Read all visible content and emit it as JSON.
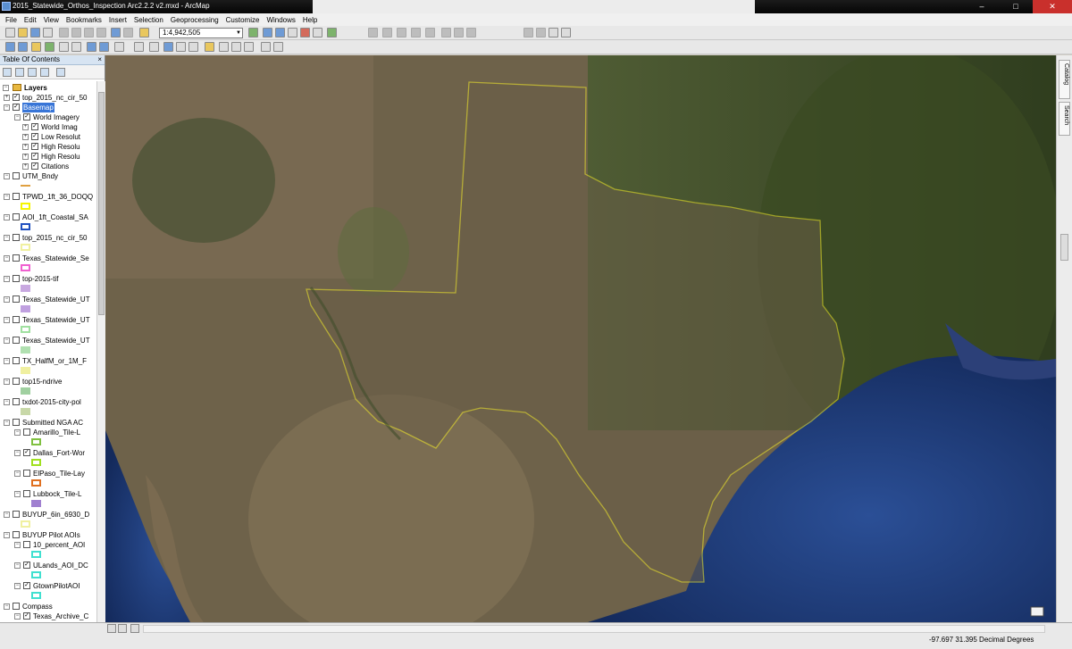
{
  "window": {
    "title": "2015_Statewide_Orthos_Inspection Arc2.2.2 v2.mxd - ArcMap",
    "controls": [
      "–",
      "□",
      "✕"
    ]
  },
  "menu": [
    "File",
    "Edit",
    "View",
    "Bookmarks",
    "Insert",
    "Selection",
    "Geoprocessing",
    "Customize",
    "Windows",
    "Help"
  ],
  "toolbar": {
    "scale_value": "1:4,942,505"
  },
  "toc": {
    "title": "Table Of Contents",
    "layers_root": "Layers",
    "rows": [
      {
        "label": "top_2015_nc_cir_50",
        "checked": true,
        "level": 1,
        "exp": "+"
      },
      {
        "label": "Basemap",
        "checked": true,
        "level": 1,
        "exp": "−",
        "selected": true
      },
      {
        "label": "World Imagery",
        "checked": true,
        "level": 2,
        "exp": "−"
      },
      {
        "label": "World Imag",
        "checked": true,
        "level": 3,
        "exp": "+"
      },
      {
        "label": "Low Resolut",
        "checked": true,
        "level": 3,
        "exp": "+"
      },
      {
        "label": "High Resolu",
        "checked": true,
        "level": 3,
        "exp": "+"
      },
      {
        "label": "High Resolu",
        "checked": true,
        "level": 3,
        "exp": "+"
      },
      {
        "label": "Citations",
        "checked": true,
        "level": 3,
        "exp": "+"
      },
      {
        "label": "UTM_Bndy",
        "checked": false,
        "level": 1,
        "exp": "−",
        "symbol": "#e0a040",
        "symbol_kind": "line"
      },
      {
        "label": "TPWD_1ft_36_DOQQ",
        "checked": false,
        "level": 1,
        "exp": "−",
        "symbol": "#f5f500"
      },
      {
        "label": "AOI_1ft_Coastal_SA",
        "checked": false,
        "level": 1,
        "exp": "−",
        "symbol": "#2050c0"
      },
      {
        "label": "top_2015_nc_cir_50",
        "checked": false,
        "level": 1,
        "exp": "−",
        "symbol": "#f0f0a0"
      },
      {
        "label": "Texas_Statewide_Se",
        "checked": false,
        "level": 1,
        "exp": "−",
        "symbol": "#f060d0"
      },
      {
        "label": "top-2015-tif",
        "checked": false,
        "level": 1,
        "exp": "−",
        "symbol": "#c8a8e0",
        "symbol_kind": "fill"
      },
      {
        "label": "Texas_Statewide_UT",
        "checked": false,
        "level": 1,
        "exp": "−",
        "symbol": "#c0a0e0",
        "symbol_kind": "fill"
      },
      {
        "label": "Texas_Statewide_UT",
        "checked": false,
        "level": 1,
        "exp": "−",
        "symbol": "#a0e0a0"
      },
      {
        "label": "Texas_Statewide_UT",
        "checked": false,
        "level": 1,
        "exp": "−",
        "symbol": "#b0e0b0",
        "symbol_kind": "fill"
      },
      {
        "label": "TX_HalfM_or_1M_F",
        "checked": false,
        "level": 1,
        "exp": "−",
        "symbol": "#f0f0a0",
        "symbol_kind": "fill"
      },
      {
        "label": "top15-ndrive",
        "checked": false,
        "level": 1,
        "exp": "−",
        "symbol": "#a0d0a0",
        "symbol_kind": "fill"
      },
      {
        "label": "txdot-2015-city-pol",
        "checked": false,
        "level": 1,
        "exp": "−",
        "symbol": "#c8d8a8",
        "symbol_kind": "fill"
      },
      {
        "label": "Submitted NGA AC",
        "checked": false,
        "level": 1,
        "exp": "−"
      },
      {
        "label": "Amarillo_Tile-L",
        "checked": false,
        "level": 2,
        "exp": "−",
        "symbol": "#80c040"
      },
      {
        "label": "Dallas_Fort-Wor",
        "checked": true,
        "level": 2,
        "exp": "−",
        "symbol": "#a0e020"
      },
      {
        "label": "ElPaso_Tile-Lay",
        "checked": false,
        "level": 2,
        "exp": "−",
        "symbol": "#e07020"
      },
      {
        "label": "Lubbock_Tile-L",
        "checked": false,
        "level": 2,
        "exp": "−",
        "symbol": "#a080d0",
        "symbol_kind": "fill"
      },
      {
        "label": "BUYUP_6in_6930_D",
        "checked": false,
        "level": 1,
        "exp": "−",
        "symbol": "#f0f0a0"
      },
      {
        "label": "BUYUP Pilot AOIs",
        "checked": false,
        "level": 1,
        "exp": "−"
      },
      {
        "label": "10_percent_AOI",
        "checked": false,
        "level": 2,
        "exp": "−",
        "symbol": "#40e0d0"
      },
      {
        "label": "ULands_AOI_DC",
        "checked": true,
        "level": 2,
        "exp": "−",
        "symbol": "#40e0d0"
      },
      {
        "label": "GtownPilotAOI",
        "checked": true,
        "level": 2,
        "exp": "−",
        "symbol": "#40e0d0"
      },
      {
        "label": "Compass",
        "checked": false,
        "level": 1,
        "exp": "−"
      },
      {
        "label": "Texas_Archive_C",
        "checked": true,
        "level": 2,
        "exp": "−",
        "symbol": "#ff40ff",
        "symbol_kind": "cross"
      }
    ]
  },
  "dock_tabs": [
    "Catalog",
    "Search"
  ],
  "status": {
    "coordinates": "-97.697  31.395 Decimal Degrees"
  },
  "colors": {
    "boundary": "#f2ea2a",
    "gulf": "#1d3a78",
    "pacific": "#1f4a8a"
  }
}
